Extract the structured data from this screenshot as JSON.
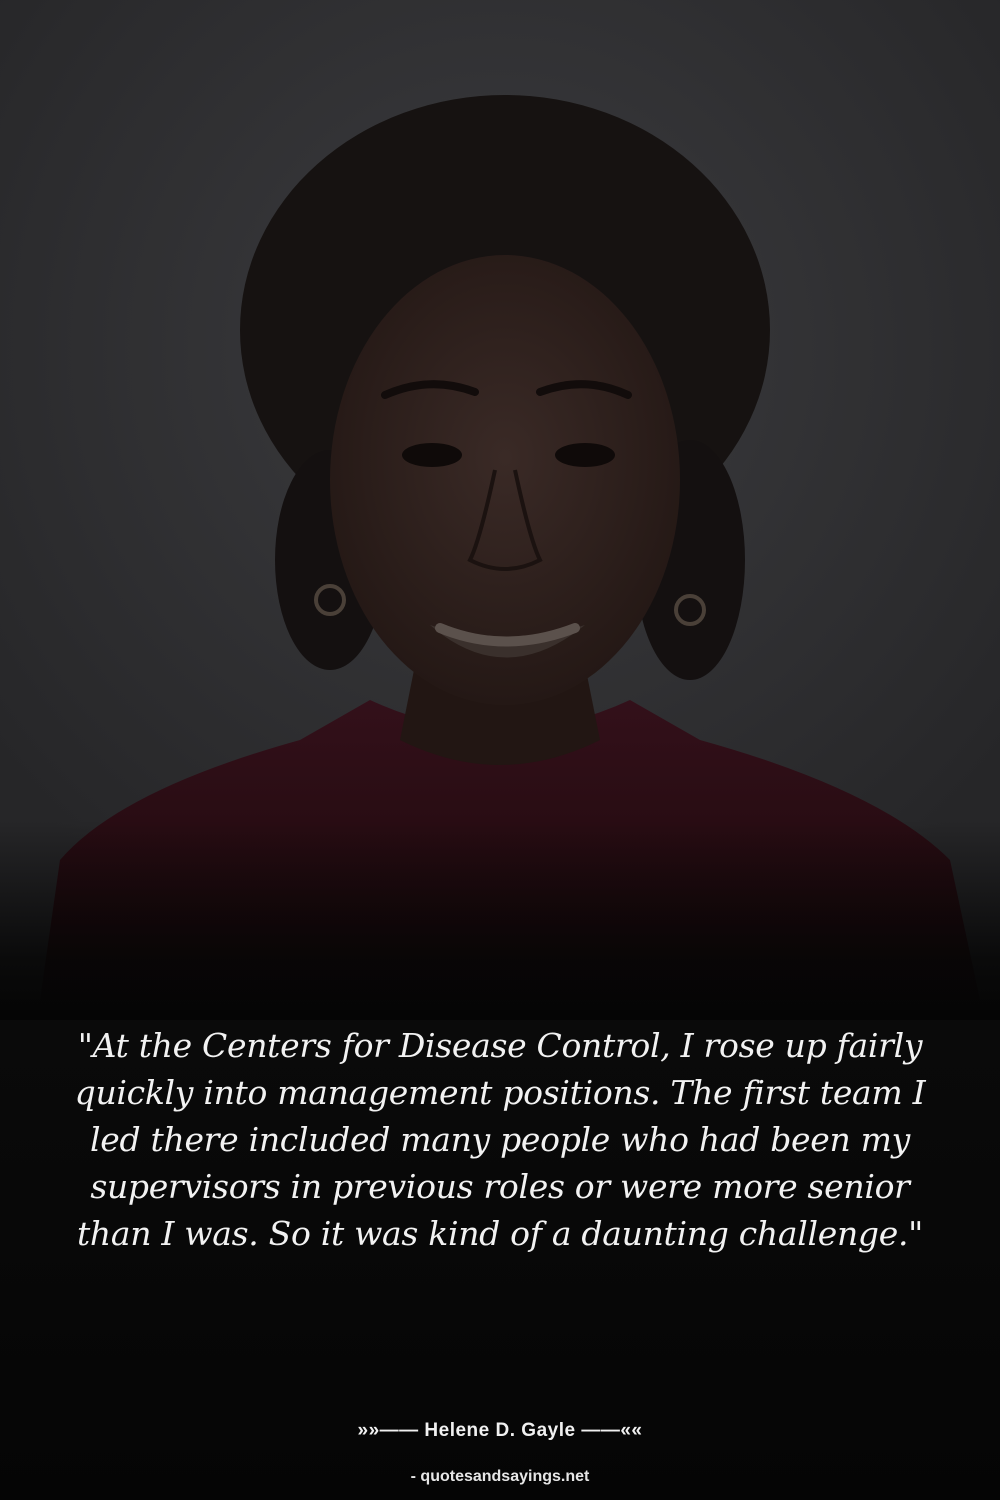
{
  "quote": {
    "text": "\"At the Centers for Disease Control, I rose up fairly quickly into management positions. The first team I led there included many people who had been my supervisors in previous roles or were more senior than I was. So it was kind of a daunting challenge.\"",
    "author_line": "»»—— Helene D. Gayle ——««",
    "source": "- quotesandsayings.net"
  },
  "colors": {
    "background_top": "#3a3a3c",
    "background_bottom": "#050505",
    "text": "#f2f2f2",
    "jacket": "#2a0c10"
  }
}
